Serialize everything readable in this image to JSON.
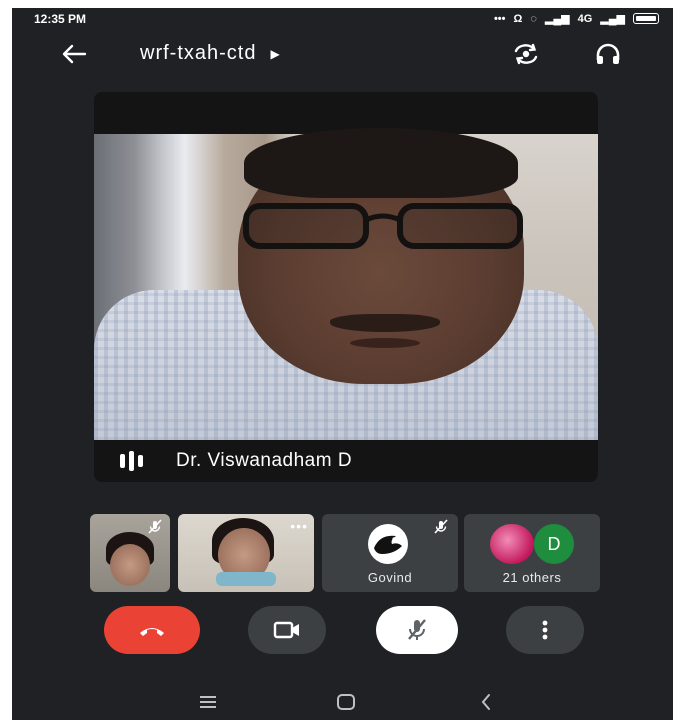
{
  "status_bar": {
    "time": "12:35 PM",
    "network": "4G"
  },
  "top_bar": {
    "meeting_code": "wrf-txah-ctd",
    "icons": [
      "arrow-left-icon",
      "caret-right-icon",
      "switch-camera-icon",
      "headphones-icon"
    ]
  },
  "main_video": {
    "speaker_name": "Dr. Viswanadham D",
    "speaking_indicator": "audio-bars-icon"
  },
  "participants": [
    {
      "label": "",
      "muted": true,
      "type": "video"
    },
    {
      "label": "",
      "muted": false,
      "type": "video",
      "more": "•••"
    },
    {
      "label": "Govind",
      "muted": true,
      "type": "avatar"
    },
    {
      "label": "21 others",
      "avatar_letter": "D",
      "type": "group"
    }
  ],
  "controls": {
    "end_call_color": "#ea4335",
    "icons": [
      "hang-up-icon",
      "video-camera-icon",
      "mic-off-icon",
      "more-vertical-icon"
    ]
  },
  "nav_bar": {
    "icons": [
      "menu-icon",
      "home-square-icon",
      "back-chevron-icon"
    ]
  },
  "colors": {
    "background": "#202124",
    "surface": "#3c4043",
    "accent_green": "#1e8e3e"
  }
}
